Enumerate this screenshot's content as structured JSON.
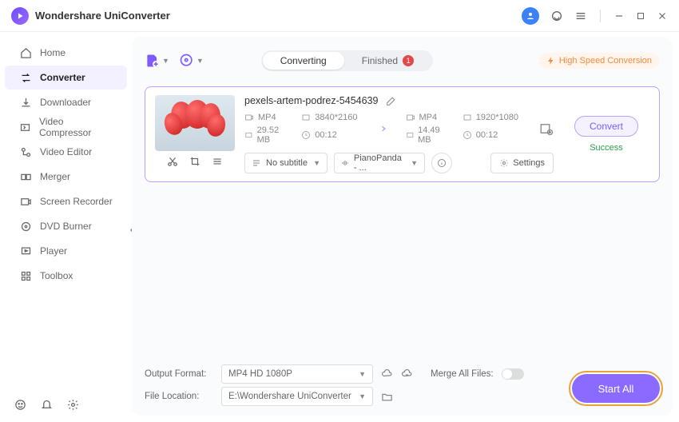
{
  "window": {
    "title": "Wondershare UniConverter"
  },
  "sidebar": {
    "items": [
      {
        "label": "Home"
      },
      {
        "label": "Converter"
      },
      {
        "label": "Downloader"
      },
      {
        "label": "Video Compressor"
      },
      {
        "label": "Video Editor"
      },
      {
        "label": "Merger"
      },
      {
        "label": "Screen Recorder"
      },
      {
        "label": "DVD Burner"
      },
      {
        "label": "Player"
      },
      {
        "label": "Toolbox"
      }
    ]
  },
  "topbar": {
    "tabs": {
      "converting": "Converting",
      "finished": "Finished",
      "finished_count": "1"
    },
    "high_speed": "High Speed Conversion"
  },
  "card": {
    "filename": "pexels-artem-podrez-5454639",
    "src": {
      "format": "MP4",
      "resolution": "3840*2160",
      "size": "29.52 MB",
      "duration": "00:12"
    },
    "dst": {
      "format": "MP4",
      "resolution": "1920*1080",
      "size": "14.49 MB",
      "duration": "00:12"
    },
    "subtitle": "No subtitle",
    "audio": "PianoPanda - ...",
    "settings_label": "Settings",
    "convert_label": "Convert",
    "status": "Success"
  },
  "footer": {
    "output_format_label": "Output Format:",
    "output_format_value": "MP4 HD 1080P",
    "file_location_label": "File Location:",
    "file_location_value": "E:\\Wondershare UniConverter",
    "merge_label": "Merge All Files:",
    "start_all": "Start All"
  }
}
